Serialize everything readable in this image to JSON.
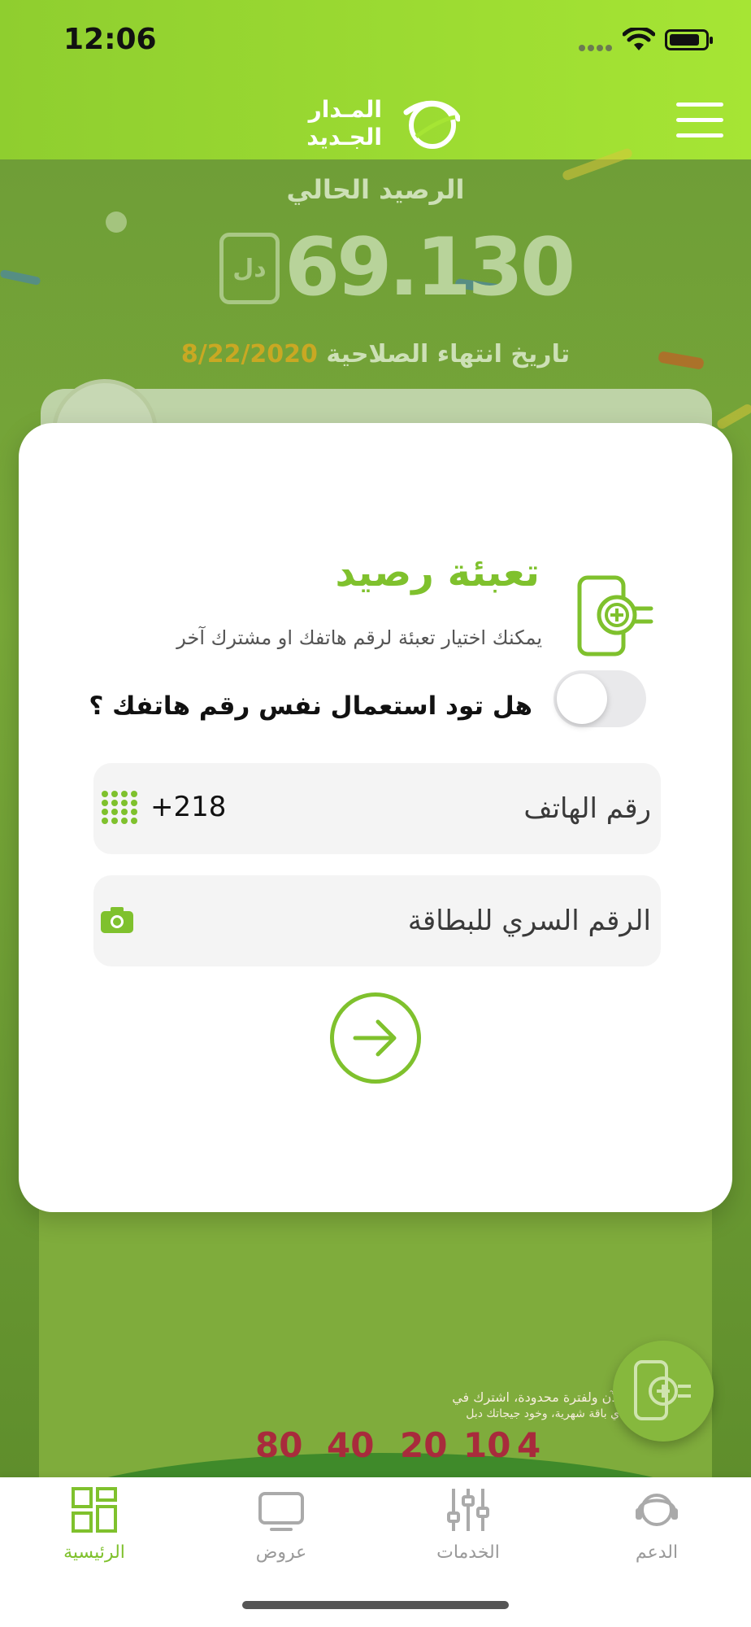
{
  "status_bar": {
    "time": "12:06"
  },
  "header": {
    "logo_line1": "المـدار",
    "logo_line2": "الجـديد"
  },
  "dashboard": {
    "balance_label": "الرصيد الحالي",
    "balance_value": "69.130",
    "currency": "دل",
    "expiry_label": "تاريخ انتهاء الصلاحية",
    "expiry_date": "8/22/2020",
    "promo_line1": "الآن ولفترة محدودة، اشترك في",
    "promo_line2": "أي باقة شهرية، وخود جيجاتك دبل",
    "promo_packages": [
      "80",
      "40",
      "20",
      "10",
      "4"
    ]
  },
  "modal": {
    "title": "تعبئة رصيد",
    "subtitle": "يمكنك اختيار تعبئة لرقم هاتفك او مشترك آخر",
    "toggle_question": "هل تود استعمال نفس رقم هاتفك ؟",
    "toggle_on": false,
    "phone_label": "رقم الهاتف",
    "phone_prefix": "+218",
    "pin_label": "الرقم السري للبطاقة"
  },
  "tabbar": {
    "tabs": [
      {
        "label": "الرئيسية",
        "icon": "grid-icon",
        "active": true
      },
      {
        "label": "عروض",
        "icon": "tv-icon",
        "active": false
      },
      {
        "label": "الخدمات",
        "icon": "sliders-icon",
        "active": false
      },
      {
        "label": "الدعم",
        "icon": "headset-icon",
        "active": false
      }
    ]
  },
  "colors": {
    "accent": "#7FC12D",
    "header": "#A6E534"
  }
}
